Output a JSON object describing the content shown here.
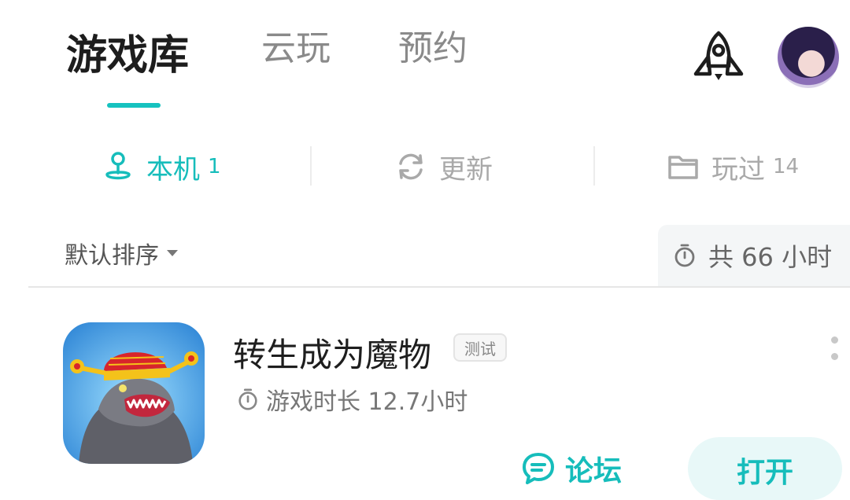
{
  "top_tabs": {
    "library": "游戏库",
    "cloud": "云玩",
    "reserve": "预约"
  },
  "sub_tabs": {
    "local": {
      "label": "本机",
      "count": "1"
    },
    "update": {
      "label": "更新"
    },
    "played": {
      "label": "玩过",
      "count": "14"
    }
  },
  "sort": {
    "label": "默认排序"
  },
  "total": {
    "label": "共 66 小时"
  },
  "game": {
    "title": "转生成为魔物",
    "badge": "测试",
    "playtime": "游戏时长 12.7小时",
    "forum_label": "论坛",
    "open_label": "打开"
  },
  "colors": {
    "accent": "#16bdbb",
    "inactive": "#a9a9a9"
  },
  "icons": [
    "rocket-icon",
    "avatar",
    "location-person-icon",
    "refresh-icon",
    "folder-icon",
    "timer-icon",
    "chat-icon",
    "more-icon"
  ]
}
